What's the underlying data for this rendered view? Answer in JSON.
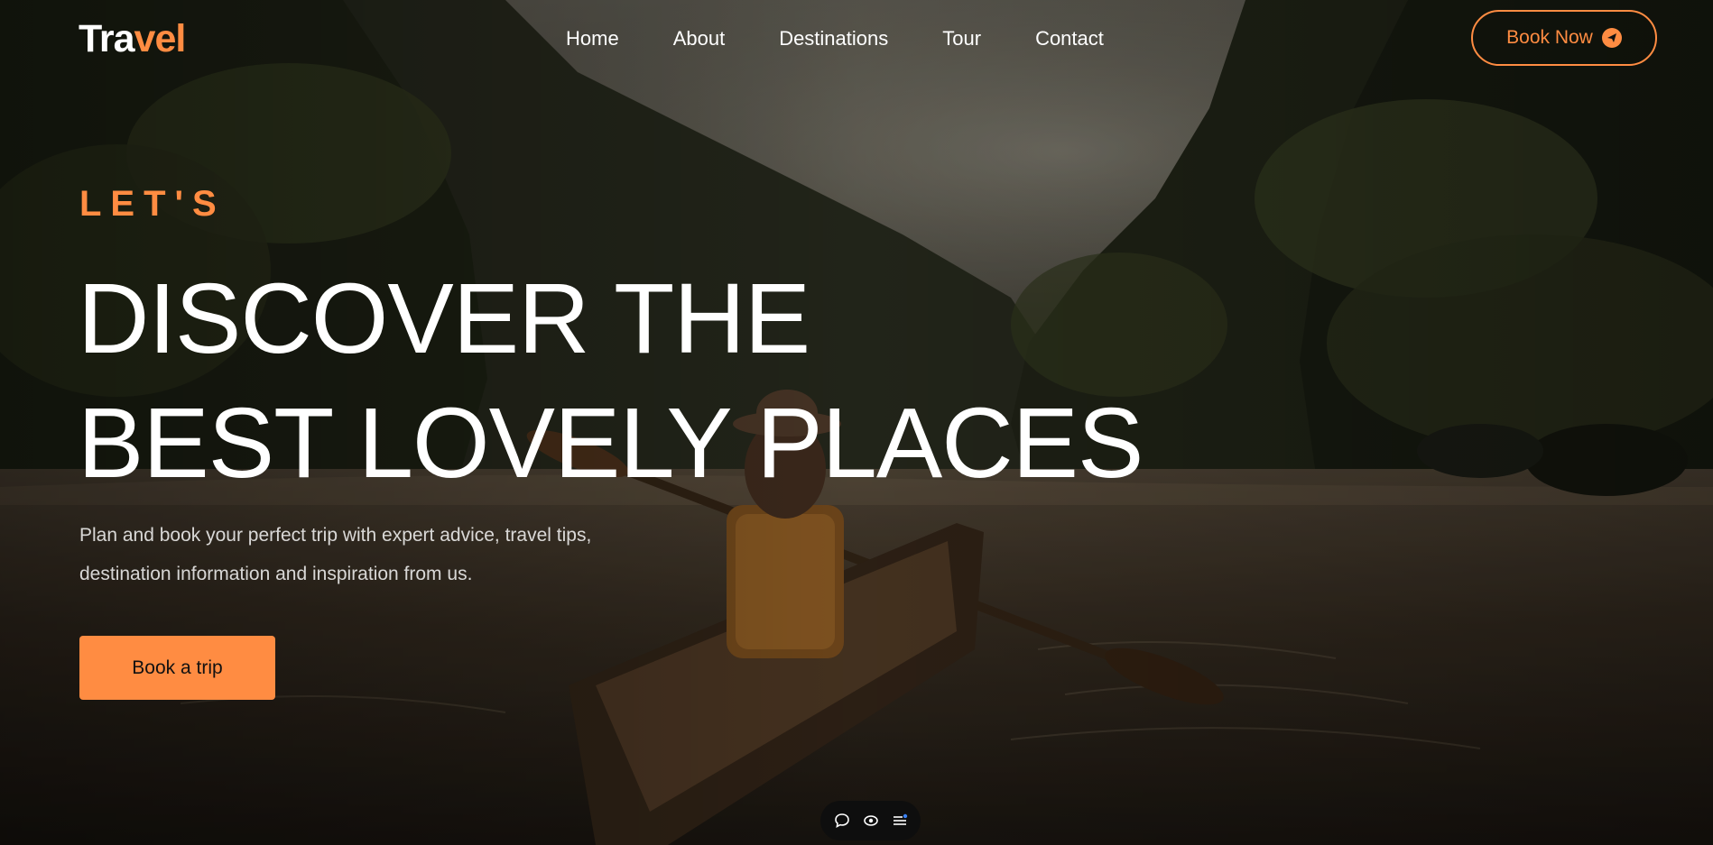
{
  "logo": {
    "part1": "Tra",
    "part2": "vel"
  },
  "nav": {
    "items": [
      {
        "label": "Home"
      },
      {
        "label": "About"
      },
      {
        "label": "Destinations"
      },
      {
        "label": "Tour"
      },
      {
        "label": "Contact"
      }
    ]
  },
  "header": {
    "cta_label": "Book Now",
    "cta_icon": "paper-plane-icon"
  },
  "hero": {
    "eyebrow": "LET'S",
    "headline_line1": "DISCOVER THE",
    "headline_line2": "BEST LOVELY PLACES",
    "description": "Plan and book your perfect trip with expert advice, travel tips, destination information and inspiration from us.",
    "cta_label": "Book a trip"
  },
  "floating_widget": {
    "icons": [
      "chat-bubble-icon",
      "eye-icon",
      "menu-list-icon"
    ]
  },
  "colors": {
    "accent": "#ff8c42",
    "text": "#ffffff",
    "widget_bg": "#0e0e0e"
  }
}
